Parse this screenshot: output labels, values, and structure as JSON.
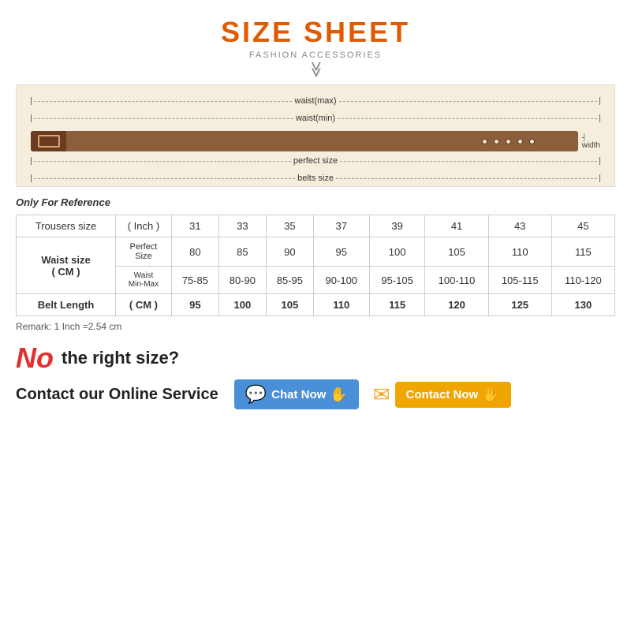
{
  "header": {
    "main_title": "SIZE SHEET",
    "subtitle": "FASHION ACCESSORIES",
    "chevron": "⌄⌄"
  },
  "belt_diagram": {
    "rows": [
      {
        "label": "waist(max)",
        "position": "top"
      },
      {
        "label": "waist(min)",
        "position": "top2"
      },
      {
        "label": "perfect size",
        "position": "bottom1"
      },
      {
        "label": "belts size",
        "position": "bottom2"
      }
    ],
    "width_label": "width"
  },
  "reference_label": "Only For Reference",
  "table": {
    "columns": [
      "",
      "",
      "31",
      "33",
      "35",
      "37",
      "39",
      "41",
      "43",
      "45"
    ],
    "row1": {
      "label": "Trousers size",
      "sub": "( Inch )"
    },
    "row2": {
      "group_label": "Waist size",
      "group_sub": "( CM )",
      "sub_rows": [
        {
          "label": "Perfect Size",
          "values": [
            "80",
            "85",
            "90",
            "95",
            "100",
            "105",
            "110",
            "115"
          ]
        },
        {
          "label": "Waist Min-Max",
          "values": [
            "75-85",
            "80-90",
            "85-95",
            "90-100",
            "95-105",
            "100-110",
            "105-115",
            "110-120"
          ]
        }
      ]
    },
    "row3": {
      "label": "Belt Length",
      "sub": "( CM )",
      "values": [
        "95",
        "100",
        "105",
        "110",
        "115",
        "120",
        "125",
        "130"
      ]
    }
  },
  "remark": "Remark: 1 Inch =2.54 cm",
  "bottom": {
    "no_text": "No",
    "question": "the right size?",
    "contact_label": "Contact our Online Service",
    "chat_btn": "Chat Now",
    "contact_btn": "Contact Now"
  }
}
